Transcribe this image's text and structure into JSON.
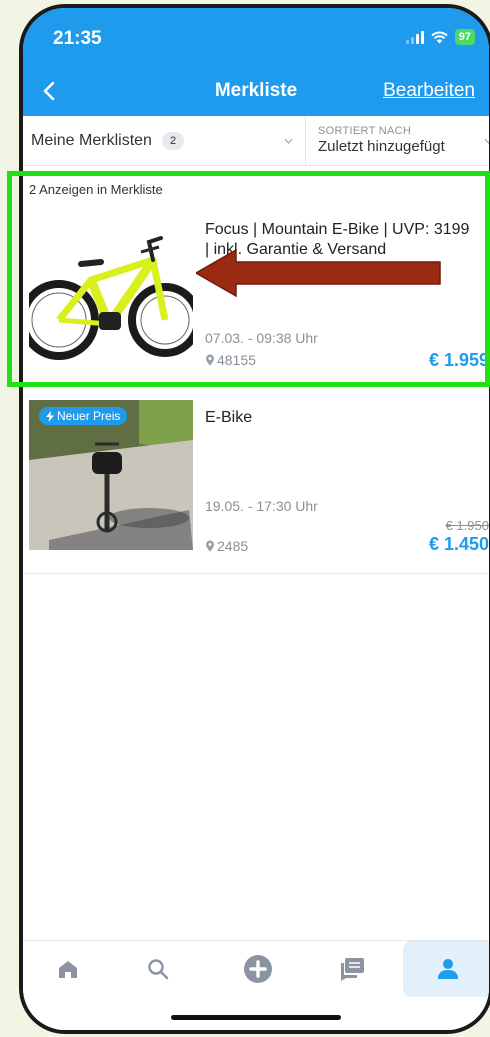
{
  "status_bar": {
    "time": "21:35",
    "battery": "97"
  },
  "header": {
    "title": "Merkliste",
    "edit_label": "Bearbeiten"
  },
  "filter": {
    "list_label": "Meine Merklisten",
    "list_count": "2",
    "sort_label": "SORTIERT NACH",
    "sort_value": "Zuletzt hinzugefügt"
  },
  "list_count_text": "2 Anzeigen in Merkliste",
  "listings": [
    {
      "title": "Focus | Mountain E-Bike | UVP: 3199 | inkl. Garantie & Versand",
      "date": "07.03. - 09:38 Uhr",
      "location": "48155",
      "price": "€ 1.959"
    },
    {
      "title": "E-Bike",
      "badge": "Neuer Preis",
      "date": "19.05. - 17:30 Uhr",
      "location": "2485",
      "old_price": "€ 1.950",
      "price": "€ 1.450"
    }
  ],
  "tabs": [
    "home-icon",
    "search-icon",
    "add-icon",
    "messages-icon",
    "profile-icon"
  ],
  "colors": {
    "brand": "#1e9bed",
    "highlight_frame": "#22e014",
    "annotation_arrow": "#9b2a14"
  }
}
